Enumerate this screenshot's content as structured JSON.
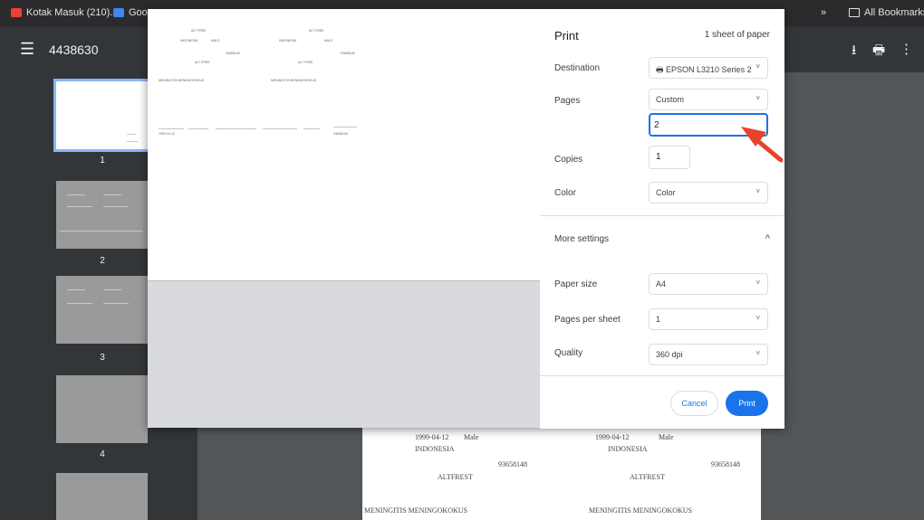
{
  "bookmarks_bar": {
    "left_items": [
      {
        "label": "Kotak Masuk (210)...",
        "icon": "gmail-icon",
        "color": "#ea4335"
      },
      {
        "label": "Goog",
        "icon": "google-icon",
        "color": "#4285f4"
      }
    ],
    "chevron": "»",
    "all_bookmarks": "All Bookmarks"
  },
  "viewer_toolbar": {
    "menu_icon": "☰",
    "title": "4438630",
    "download_icon": "⭳",
    "print_icon": "🖶",
    "more_icon": "⋮"
  },
  "sidebar": {
    "thumbnails": [
      {
        "page": "1"
      },
      {
        "page": "2"
      },
      {
        "page": "3"
      },
      {
        "page": "4"
      }
    ]
  },
  "document_page": {
    "left_col": [
      "1999-04-12",
      "Male",
      "INDONESIA",
      "93658148",
      "ALTFREST",
      "MENINGITIS MENINGOKOKUS"
    ],
    "right_col": [
      "1999-04-12",
      "Male",
      "INDONESIA",
      "93658148",
      "ALTFREST",
      "MENINGITIS MENINGOKOKUS"
    ]
  },
  "print_dialog": {
    "title": "Print",
    "sheets": "1 sheet of paper",
    "destination": {
      "label": "Destination",
      "value": "EPSON L3210 Series 2",
      "icon": "printer-icon"
    },
    "pages": {
      "label": "Pages",
      "value": "Custom",
      "custom_value": "2"
    },
    "copies": {
      "label": "Copies",
      "value": "1"
    },
    "color": {
      "label": "Color",
      "value": "Color"
    },
    "more_settings": {
      "label": "More settings",
      "chevron": "^"
    },
    "paper_size": {
      "label": "Paper size",
      "value": "A4"
    },
    "pages_per_sheet": {
      "label": "Pages per sheet",
      "value": "1"
    },
    "quality": {
      "label": "Quality",
      "value": "360 dpi"
    },
    "cancel_label": "Cancel",
    "print_label": "Print",
    "dropdown_chevron": "˅"
  },
  "preview": {
    "snippets": [
      "ALT FREE",
      "INDONESIA",
      "MALE",
      "93658148",
      "MENINGITIS MENINGOKOKUS",
      "1999-04-12"
    ]
  },
  "colors": {
    "accent": "#1a73e8",
    "annotation_arrow": "#e8432a",
    "toolbar": "#323639"
  }
}
